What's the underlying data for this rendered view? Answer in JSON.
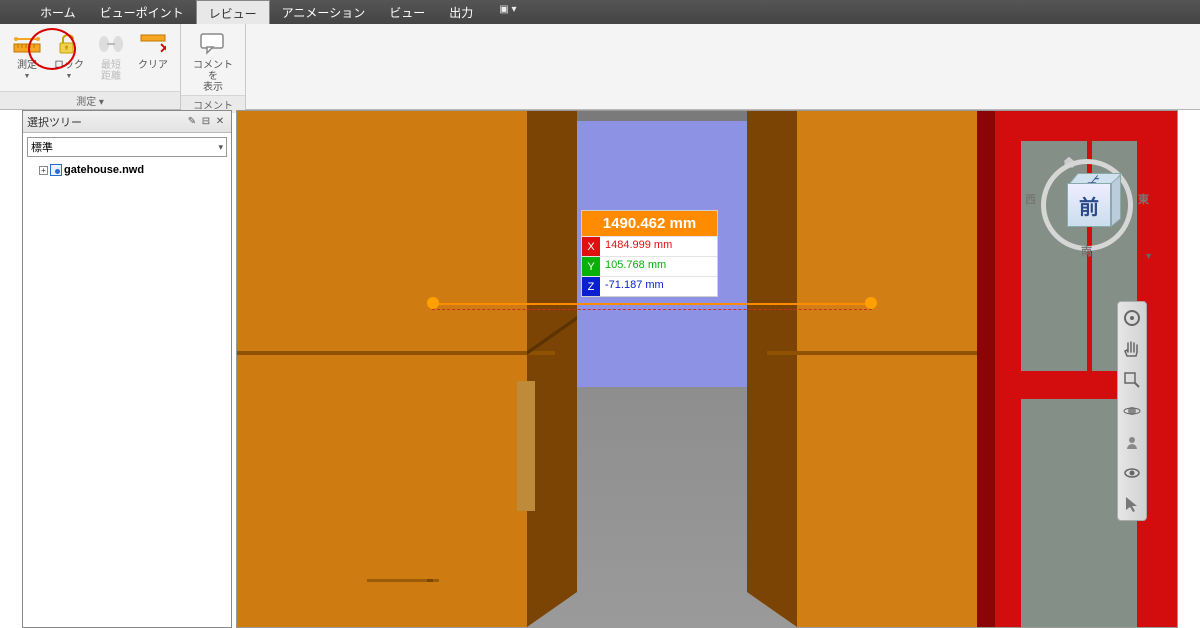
{
  "menubar": {
    "items": [
      "ホーム",
      "ビューポイント",
      "レビュー",
      "アニメーション",
      "ビュー",
      "出力"
    ],
    "active_index": 2
  },
  "ribbon": {
    "group_measure": {
      "label": "測定 ▾",
      "buttons": {
        "measure": {
          "label": "測定",
          "has_dropdown": true
        },
        "lock": {
          "label": "ロック",
          "has_dropdown": true
        },
        "shortest": {
          "label": "最短\n距離",
          "disabled": true
        },
        "clear": {
          "label": "クリア"
        }
      }
    },
    "group_comment": {
      "label": "コメント",
      "buttons": {
        "show_comments": {
          "label": "コメントを\n表示"
        }
      }
    }
  },
  "tree": {
    "title": "選択ツリー",
    "dropdown": "標準",
    "root": "gatehouse.nwd"
  },
  "measurement": {
    "total": "1490.462 mm",
    "x": {
      "axis": "X",
      "value": "1484.999 mm"
    },
    "y": {
      "axis": "Y",
      "value": "105.768 mm"
    },
    "z": {
      "axis": "Z",
      "value": "-71.187 mm"
    }
  },
  "viewcube": {
    "front": "前",
    "top": "上",
    "compass": {
      "n": "上",
      "e": "東",
      "s": "南",
      "w": "西"
    }
  },
  "colors": {
    "accent_orange": "#ff8c00",
    "axis_x": "#e01010",
    "axis_y": "#08b008",
    "axis_z": "#0a20d0",
    "highlight_ring": "#d80000"
  }
}
